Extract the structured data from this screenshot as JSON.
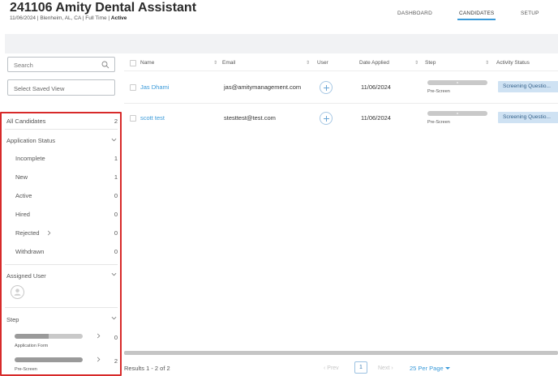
{
  "header": {
    "title": "241106 Amity Dental Assistant",
    "meta_prefix": "11/06/2024 | Blenheim, AL, CA | Full Time | ",
    "meta_status": "Active",
    "nav": {
      "dashboard": "DASHBOARD",
      "candidates": "CANDIDATES",
      "setup": "SETUP"
    }
  },
  "sidebar": {
    "search_placeholder": "Search",
    "saved_view": "Select Saved View",
    "all_candidates": {
      "label": "All Candidates",
      "count": "2"
    },
    "application_status": {
      "title": "Application Status",
      "items": [
        {
          "label": "Incomplete",
          "count": "1"
        },
        {
          "label": "New",
          "count": "1"
        },
        {
          "label": "Active",
          "count": "0"
        },
        {
          "label": "Hired",
          "count": "0"
        },
        {
          "label": "Rejected",
          "count": "0"
        },
        {
          "label": "Withdrawn",
          "count": "0"
        }
      ]
    },
    "assigned_user": {
      "title": "Assigned User"
    },
    "step": {
      "title": "Step",
      "items": [
        {
          "label": "Application Form",
          "count": "0",
          "progress": 0.5
        },
        {
          "label": "Pre-Screen",
          "count": "2",
          "progress": 1.0
        }
      ]
    }
  },
  "table": {
    "columns": [
      "Name",
      "Email",
      "User",
      "Date Applied",
      "Step",
      "Activity Status"
    ],
    "rows": [
      {
        "name": "Jas Dhami",
        "email": "jas@amitymanagement.com",
        "date": "11/06/2024",
        "stage": "Pre-Screen",
        "activity": "Screening Questio..."
      },
      {
        "name": "scott test",
        "email": "stesttest@test.com",
        "date": "11/06/2024",
        "stage": "Pre-Screen",
        "activity": "Screening Questio..."
      }
    ]
  },
  "footer": {
    "results": "Results 1 - 2 of 2",
    "prev": "Prev",
    "page": "1",
    "next": "Next",
    "per_page": "25 Per Page"
  },
  "colors": {
    "accent": "#3a9ad9",
    "highlight_border": "#d72a2a",
    "activity_badge": "#cfe2f3"
  }
}
